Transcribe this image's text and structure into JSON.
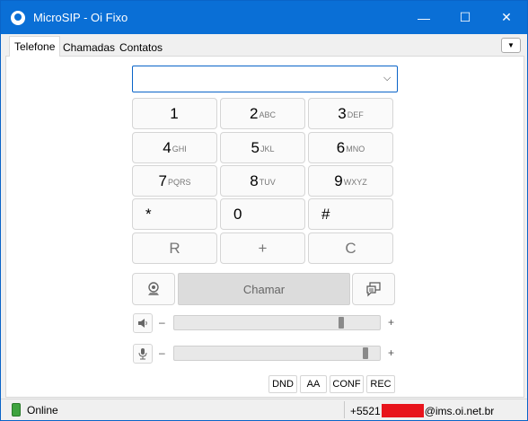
{
  "window": {
    "title": "MicroSIP - Oi Fixo",
    "controls": {
      "minimize": "—",
      "maximize": "☐",
      "close": "✕"
    }
  },
  "tabs": [
    {
      "label": "Telefone",
      "active": true
    },
    {
      "label": "Chamadas",
      "active": false
    },
    {
      "label": "Contatos",
      "active": false
    }
  ],
  "menu_button": {
    "icon": "triangle-down-icon",
    "glyph": "▼"
  },
  "dialer": {
    "number_value": "",
    "combo_arrow": "⌵",
    "keys": [
      {
        "digit": "1",
        "letters": ""
      },
      {
        "digit": "2",
        "letters": "ABC"
      },
      {
        "digit": "3",
        "letters": "DEF"
      },
      {
        "digit": "4",
        "letters": "GHI"
      },
      {
        "digit": "5",
        "letters": "JKL"
      },
      {
        "digit": "6",
        "letters": "MNO"
      },
      {
        "digit": "7",
        "letters": "PQRS"
      },
      {
        "digit": "8",
        "letters": "TUV"
      },
      {
        "digit": "9",
        "letters": "WXYZ"
      },
      {
        "digit": "*",
        "letters": ""
      },
      {
        "digit": "0",
        "letters": ""
      },
      {
        "digit": "#",
        "letters": ""
      }
    ],
    "function_keys": [
      {
        "label": "R"
      },
      {
        "label": "+"
      },
      {
        "label": "C"
      }
    ],
    "call_label": "Chamar",
    "video_call_icon": "webcam-icon",
    "message_icon": "chat-icon"
  },
  "volume": {
    "speaker": {
      "icon": "speaker-icon",
      "minus": "–",
      "plus": "+",
      "level": 0.82
    },
    "microphone": {
      "icon": "microphone-icon",
      "minus": "–",
      "plus": "+",
      "level": 0.94
    }
  },
  "options": [
    "DND",
    "AA",
    "CONF",
    "REC"
  ],
  "status": {
    "text": "Online",
    "color": "#3fa33f",
    "account_prefix": "+5521",
    "account_suffix": "@ims.oi.net.br",
    "redaction_color": "#e8141c"
  },
  "accent": "#0a6fd6"
}
